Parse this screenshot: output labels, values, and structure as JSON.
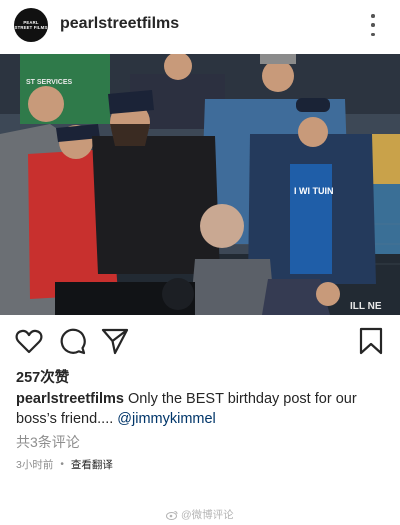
{
  "post": {
    "username": "pearlstreetfilms",
    "avatar_text": "PEARL STREET FILMS",
    "more_icon": "more-vertical-icon"
  },
  "photo": {
    "jersey_text": "I WI TUIN",
    "board_text": "ILL NE",
    "banner_text": "ST SERVICES"
  },
  "actions": {
    "like_icon": "heart-outline-icon",
    "comment_icon": "comment-bubble-icon",
    "share_icon": "paper-plane-icon",
    "save_icon": "bookmark-icon"
  },
  "likes": "257次赞",
  "caption": {
    "user": "pearlstreetfilms",
    "text": " Only the BEST birthday post for our boss’s friend.... ",
    "mention": "@jimmykimmel"
  },
  "comments_link": "共3条评论",
  "time": "3小时前",
  "separator": "•",
  "translate": "查看翻译",
  "watermark": "@微博评论",
  "colors": {
    "text": "#262626",
    "secondary": "#8e8e8e",
    "mention": "#003569"
  }
}
